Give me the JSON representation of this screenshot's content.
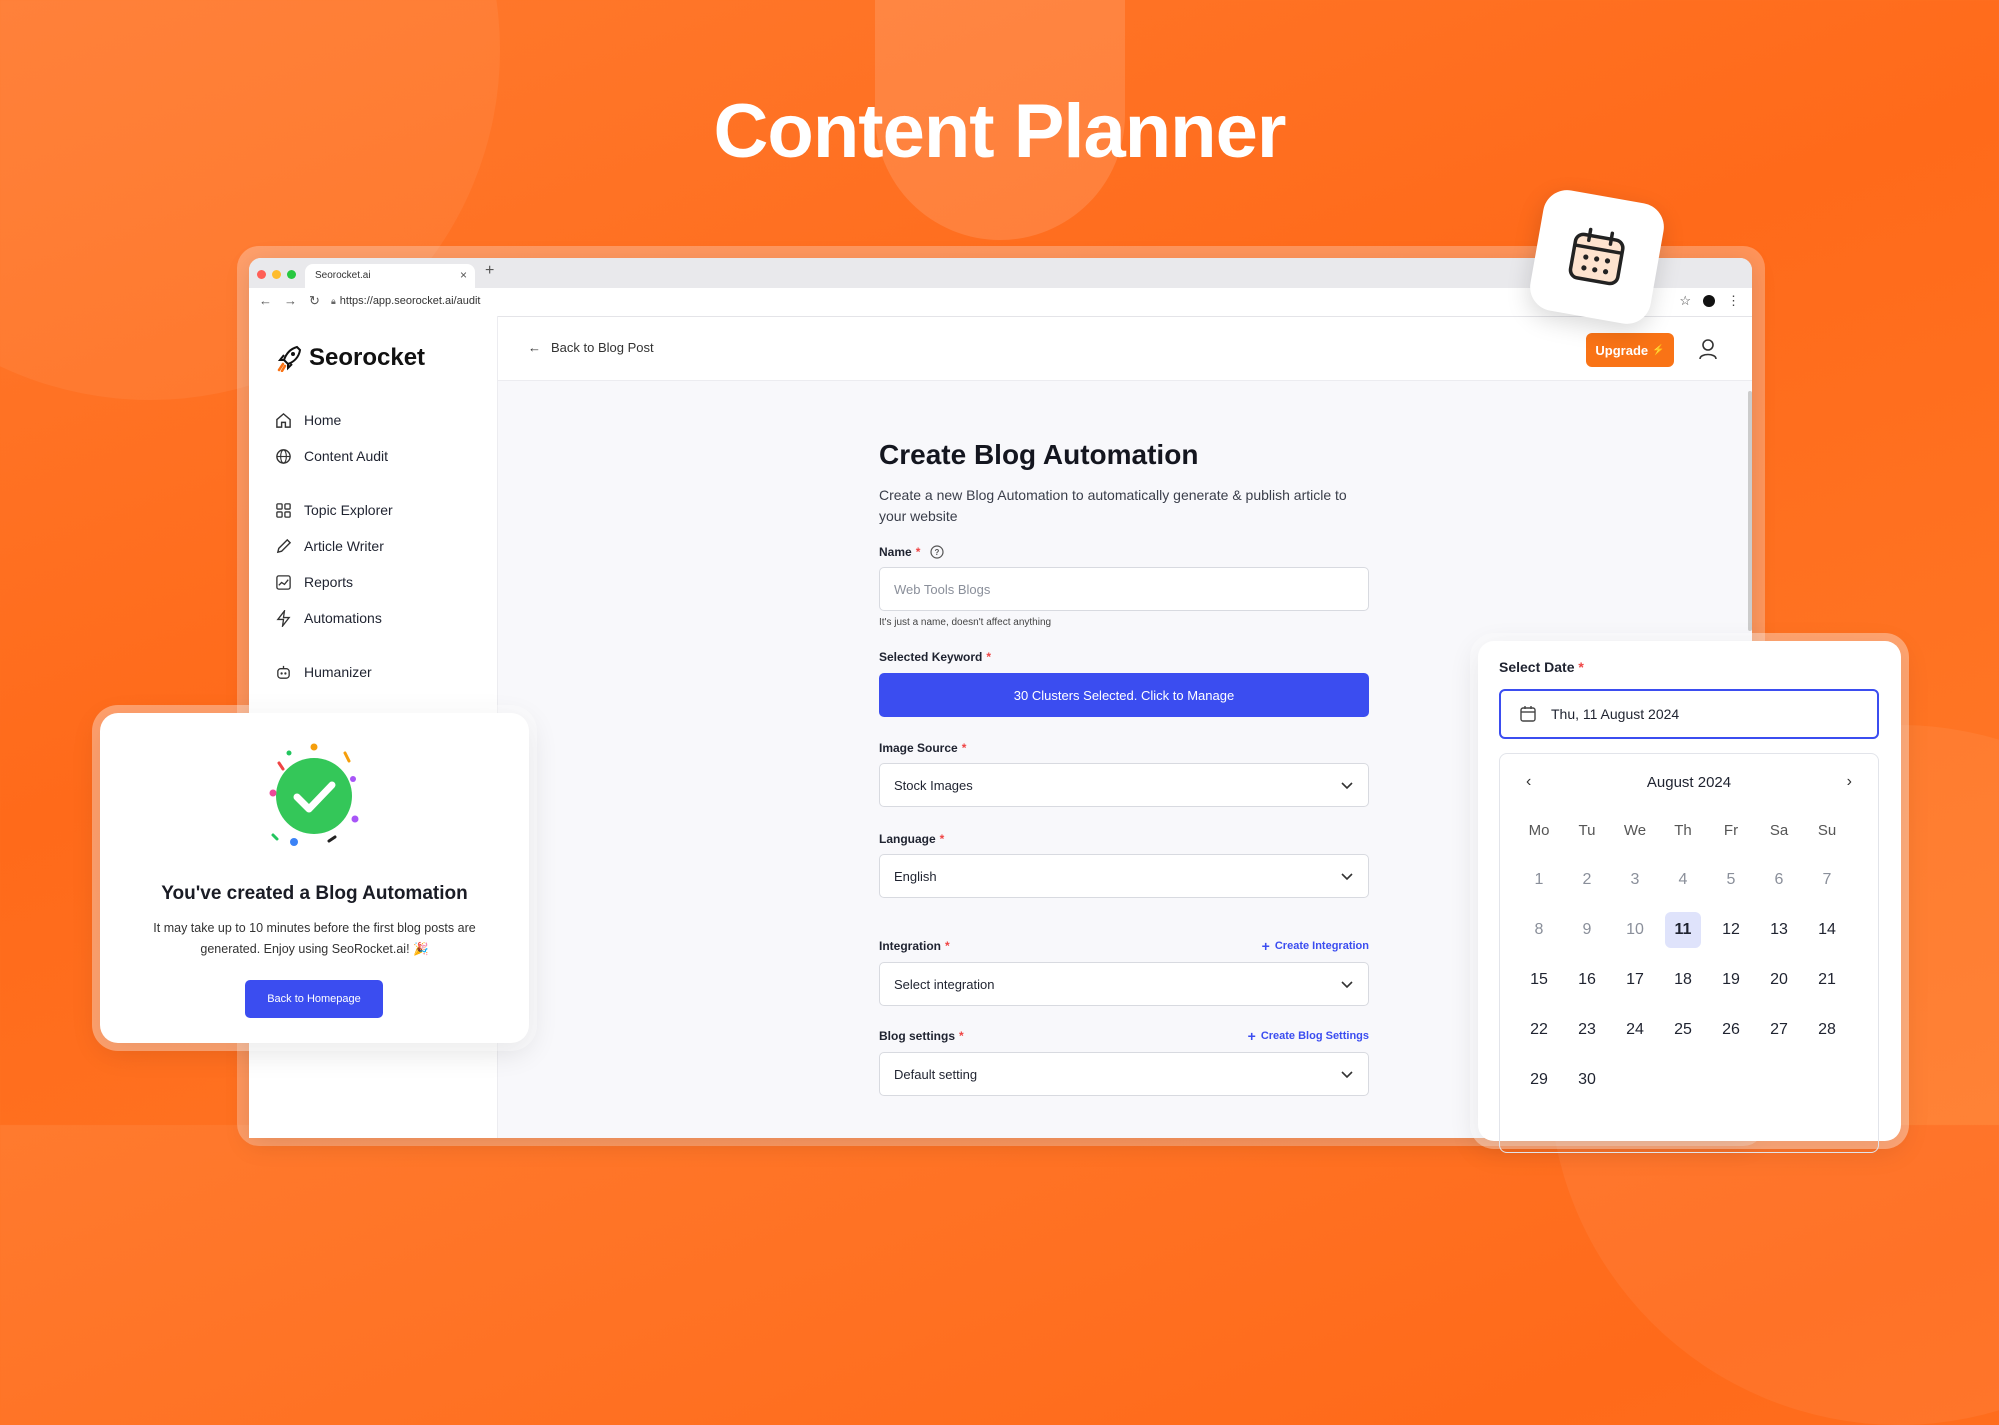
{
  "hero": {
    "title": "Content Planner"
  },
  "browser": {
    "tab_title": "Seorocket.ai",
    "tab_close": "×",
    "new_tab": "+",
    "url": "https://app.seorocket.ai/audit"
  },
  "brand": {
    "name": "Seorocket"
  },
  "sidebar": {
    "items": [
      {
        "label": "Home",
        "icon": "home-icon"
      },
      {
        "label": "Content Audit",
        "icon": "globe-icon"
      },
      {
        "label": "Topic Explorer",
        "icon": "grid-icon"
      },
      {
        "label": "Article Writer",
        "icon": "pencil-icon"
      },
      {
        "label": "Reports",
        "icon": "chart-icon"
      },
      {
        "label": "Automations",
        "icon": "bolt-icon"
      },
      {
        "label": "Humanizer",
        "icon": "robot-icon"
      }
    ]
  },
  "topbar": {
    "back_label": "Back to Blog Post",
    "upgrade_label": "Upgrade",
    "upgrade_glyph": "⚡"
  },
  "form": {
    "title": "Create Blog Automation",
    "subtitle": "Create a new Blog Automation to automatically generate & publish article to your website",
    "name_label": "Name",
    "name_placeholder": "Web Tools Blogs",
    "name_hint": "It's just a name, doesn't affect anything",
    "keyword_label": "Selected Keyword",
    "keyword_button": "30 Clusters Selected. Click to Manage",
    "image_source_label": "Image Source",
    "image_source_value": "Stock Images",
    "language_label": "Language",
    "language_value": "English",
    "integration_label": "Integration",
    "integration_create": "Create Integration",
    "integration_value": "Select integration",
    "blog_settings_label": "Blog settings",
    "blog_settings_create": "Create Blog Settings",
    "blog_settings_value": "Default setting",
    "required_mark": "*"
  },
  "success": {
    "title": "You've created a Blog Automation",
    "text": "It may take up to 10 minutes before the first blog posts are generated. Enjoy using SeoRocket.ai! 🎉",
    "button": "Back to Homepage"
  },
  "date_picker": {
    "label": "Select Date",
    "value": "Thu, 11 August 2024",
    "month": "August 2024",
    "weekdays": [
      "Mo",
      "Tu",
      "We",
      "Th",
      "Fr",
      "Sa",
      "Su"
    ],
    "days": [
      [
        1,
        2,
        3,
        4,
        5,
        6,
        7
      ],
      [
        8,
        9,
        10,
        11,
        12,
        13,
        14
      ],
      [
        15,
        16,
        17,
        18,
        19,
        20,
        21
      ],
      [
        22,
        23,
        24,
        25,
        26,
        27,
        28
      ],
      [
        29,
        30
      ]
    ],
    "selected_day": 11,
    "muted_through": 10
  },
  "colors": {
    "accent": "#3b4df0",
    "brand_orange": "#f97316",
    "required": "#ef4444"
  }
}
